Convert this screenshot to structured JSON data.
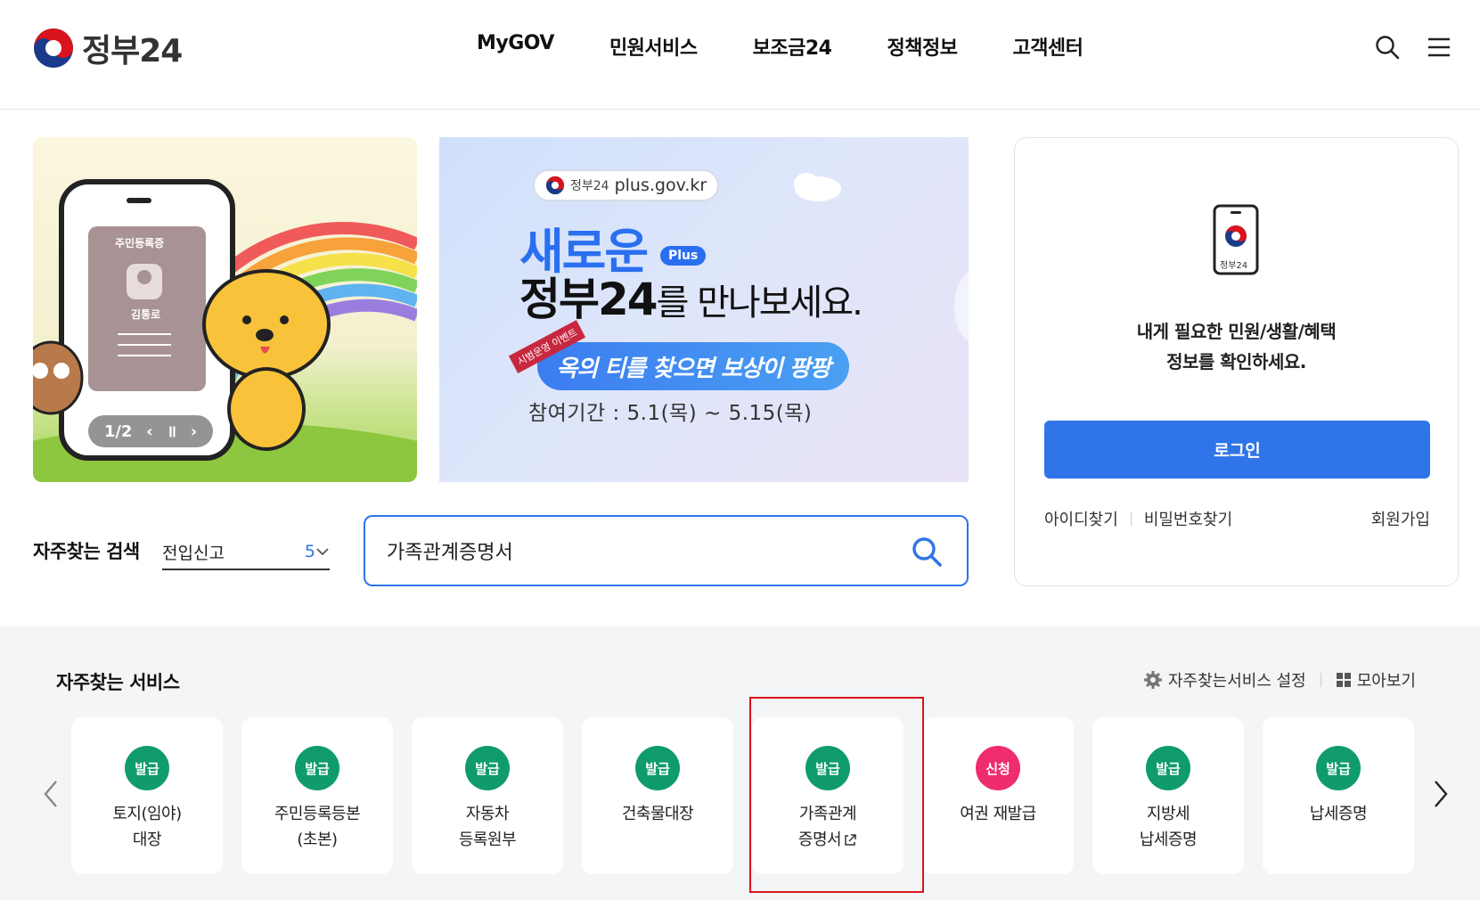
{
  "header": {
    "logo_text": "정부24",
    "nav": [
      "MyGOV",
      "민원서비스",
      "보조금24",
      "정책정보",
      "고객센터"
    ]
  },
  "banner_left": {
    "card_title": "주민등록증",
    "card_name": "김통로",
    "counter": "1/2"
  },
  "banner_right": {
    "pill_brand": "정부24",
    "pill_url": "plus.gov.kr",
    "title_line1": "새로운",
    "plus_badge": "Plus",
    "title_line2_bold": "정부24",
    "title_line2_rest": "를 만나보세요.",
    "ribbon": "시범운영 이벤트",
    "event_text": "옥의 티를 찾으면 보상이 팡팡",
    "period": "참여기간 : 5.1(목) ~ 5.15(목)"
  },
  "login": {
    "phone_caption": "정부24",
    "message_line1": "내게 필요한 민원/생활/혜택",
    "message_line2": "정보를 확인하세요.",
    "login_button": "로그인",
    "find_id": "아이디찾기",
    "find_pw": "비밀번호찾기",
    "signup": "회원가입"
  },
  "frequent_search": {
    "label": "자주찾는 검색",
    "selected": "전입신고",
    "number": "5"
  },
  "search": {
    "value": "가족관계증명서"
  },
  "services": {
    "title": "자주찾는 서비스",
    "settings": "자주찾는서비스 설정",
    "view_all": "모아보기",
    "items": [
      {
        "badge": "발급",
        "label": "토지(임야)\n대장"
      },
      {
        "badge": "발급",
        "label": "주민등록등본\n(초본)"
      },
      {
        "badge": "발급",
        "label": "자동차\n등록원부"
      },
      {
        "badge": "발급",
        "label": "건축물대장"
      },
      {
        "badge": "발급",
        "label": "가족관계\n증명서"
      },
      {
        "badge": "신청",
        "label": "여권 재발급"
      },
      {
        "badge": "발급",
        "label": "지방세\n납세증명"
      },
      {
        "badge": "발급",
        "label": "납세증명"
      }
    ]
  },
  "colors": {
    "primary": "#2f74e8",
    "badge_green": "#0f9b6e",
    "badge_pink": "#ef2d6d",
    "highlight": "#d9141c"
  }
}
